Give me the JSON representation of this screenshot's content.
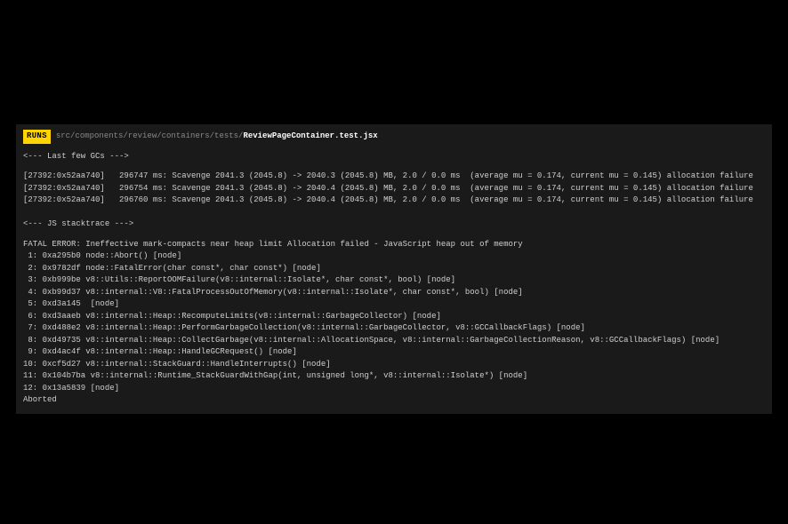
{
  "header": {
    "badge": "RUNS",
    "pathDim": "src/components/review/containers/tests/",
    "pathBright": "ReviewPageContainer.test.jsx"
  },
  "sections": {
    "gcHeader": "<--- Last few GCs --->",
    "gcLines": [
      "[27392:0x52aa740]   296747 ms: Scavenge 2041.3 (2045.8) -> 2040.3 (2045.8) MB, 2.0 / 0.0 ms  (average mu = 0.174, current mu = 0.145) allocation failure",
      "[27392:0x52aa740]   296754 ms: Scavenge 2041.3 (2045.8) -> 2040.4 (2045.8) MB, 2.0 / 0.0 ms  (average mu = 0.174, current mu = 0.145) allocation failure",
      "[27392:0x52aa740]   296760 ms: Scavenge 2041.3 (2045.8) -> 2040.4 (2045.8) MB, 2.0 / 0.0 ms  (average mu = 0.174, current mu = 0.145) allocation failure"
    ],
    "stackHeader": "<--- JS stacktrace --->",
    "fatal": "FATAL ERROR: Ineffective mark-compacts near heap limit Allocation failed - JavaScript heap out of memory",
    "frames": [
      " 1: 0xa295b0 node::Abort() [node]",
      " 2: 0x9782df node::FatalError(char const*, char const*) [node]",
      " 3: 0xb999be v8::Utils::ReportOOMFailure(v8::internal::Isolate*, char const*, bool) [node]",
      " 4: 0xb99d37 v8::internal::V8::FatalProcessOutOfMemory(v8::internal::Isolate*, char const*, bool) [node]",
      " 5: 0xd3a145  [node]",
      " 6: 0xd3aaeb v8::internal::Heap::RecomputeLimits(v8::internal::GarbageCollector) [node]",
      " 7: 0xd488e2 v8::internal::Heap::PerformGarbageCollection(v8::internal::GarbageCollector, v8::GCCallbackFlags) [node]",
      " 8: 0xd49735 v8::internal::Heap::CollectGarbage(v8::internal::AllocationSpace, v8::internal::GarbageCollectionReason, v8::GCCallbackFlags) [node]",
      " 9: 0xd4ac4f v8::internal::Heap::HandleGCRequest() [node]",
      "10: 0xcf5d27 v8::internal::StackGuard::HandleInterrupts() [node]",
      "11: 0x104b7ba v8::internal::Runtime_StackGuardWithGap(int, unsigned long*, v8::internal::Isolate*) [node]",
      "12: 0x13a5839 [node]"
    ],
    "aborted": "Aborted"
  }
}
